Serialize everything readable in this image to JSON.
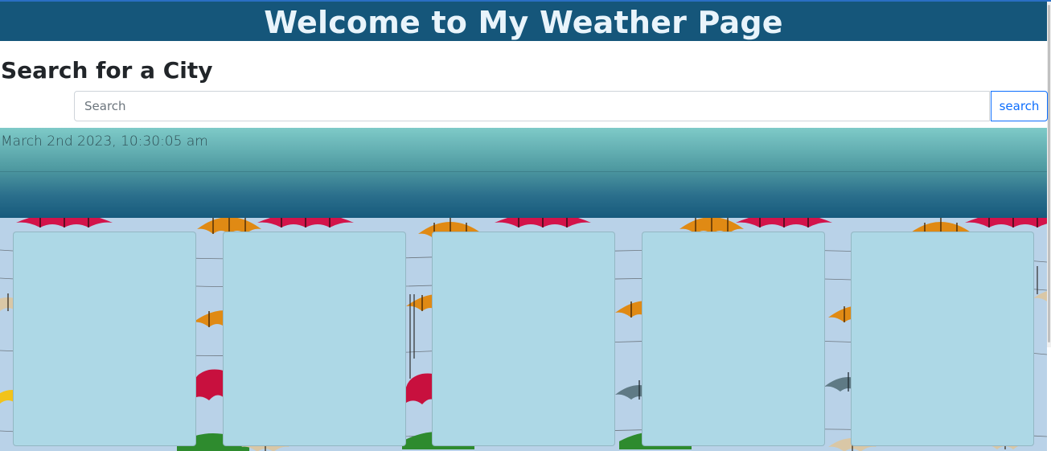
{
  "header": {
    "title": "Welcome to My Weather Page"
  },
  "search": {
    "heading": "Search for a City",
    "placeholder": "Search",
    "value": "",
    "button_label": "search"
  },
  "current": {
    "datetime": "March 2nd 2023, 10:30:05 am"
  },
  "forecast": {
    "cards": [
      {
        "id": 1
      },
      {
        "id": 2
      },
      {
        "id": 3
      },
      {
        "id": 4
      },
      {
        "id": 5
      }
    ]
  },
  "colors": {
    "header_bg": "#15567a",
    "card_bg": "#add8e6",
    "button_accent": "#0d6efd"
  },
  "background": {
    "image": "colorful-umbrellas-sky"
  }
}
